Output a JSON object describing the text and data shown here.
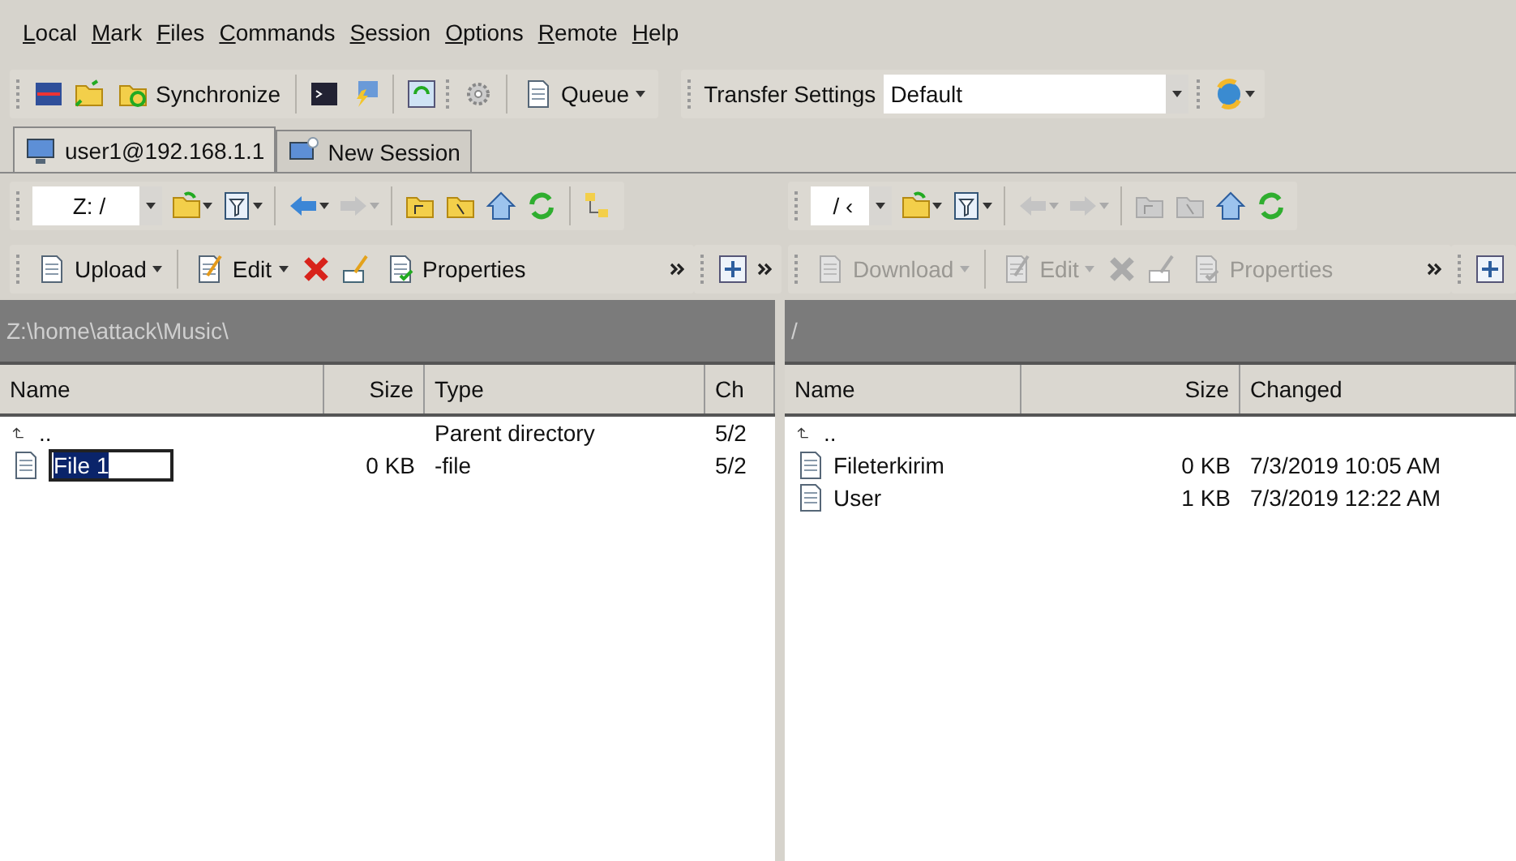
{
  "menu": [
    {
      "mnemonic": "L",
      "rest": "ocal"
    },
    {
      "mnemonic": "M",
      "rest": "ark"
    },
    {
      "mnemonic": "F",
      "rest": "iles"
    },
    {
      "mnemonic": "C",
      "rest": "ommands"
    },
    {
      "mnemonic": "S",
      "rest": "ession"
    },
    {
      "mnemonic": "O",
      "rest": "ptions"
    },
    {
      "mnemonic": "R",
      "rest": "emote"
    },
    {
      "mnemonic": "H",
      "rest": "elp"
    }
  ],
  "toolbar": {
    "synchronize": "Synchronize",
    "queue": "Queue",
    "transfer_label": "Transfer Settings",
    "transfer_value": "Default"
  },
  "tabs": [
    {
      "label": "user1@192.168.1.1",
      "selected": true
    },
    {
      "label": "New Session",
      "selected": false
    }
  ],
  "panes": [
    {
      "path_combo": "Z: /",
      "path": "Z:\\home\\attack\\Music\\",
      "back_disabled": false,
      "folders_disabled": false,
      "actions_disabled": false,
      "transfer": "Upload",
      "edit": "Edit",
      "properties": "Properties",
      "columns": [
        "Name",
        "Size",
        "Type",
        "Ch"
      ],
      "rows": [
        {
          "kind": "parent",
          "name": "..",
          "type": "Parent directory",
          "changed": "5/2"
        },
        {
          "kind": "file",
          "name": "File 1",
          "size": "0 KB",
          "type": "-file",
          "changed": "5/2",
          "renaming": true
        }
      ]
    },
    {
      "path_combo": "/ ‹",
      "path": "/",
      "back_disabled": true,
      "folders_disabled": true,
      "actions_disabled": true,
      "transfer": "Download",
      "edit": "Edit",
      "properties": "Properties",
      "columns": [
        "Name",
        "Size",
        "Changed"
      ],
      "rows": [
        {
          "kind": "parent",
          "name": ".."
        },
        {
          "kind": "file",
          "name": "Fileterkirim",
          "size": "0 KB",
          "changed": "7/3/2019 10:05 AM",
          "renaming": false
        },
        {
          "kind": "file",
          "name": "User",
          "size": "1 KB",
          "changed": "7/3/2019 12:22 AM",
          "renaming": false
        }
      ]
    }
  ]
}
